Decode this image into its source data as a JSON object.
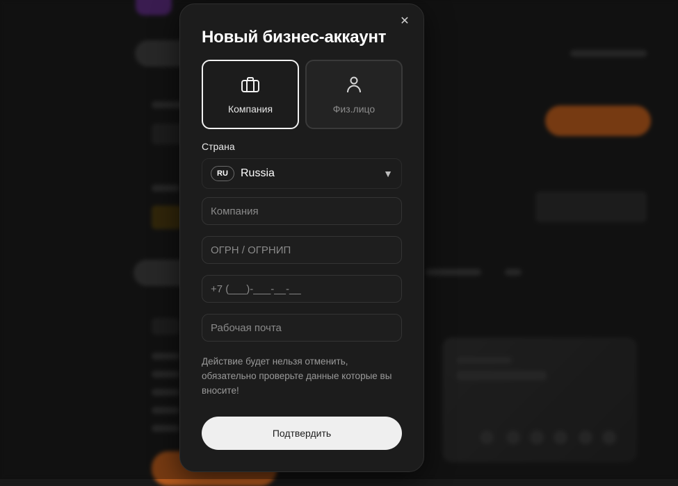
{
  "modal": {
    "title": "Новый бизнес-аккаунт",
    "close_glyph": "✕",
    "account_types": [
      {
        "label": "Компания",
        "icon": "briefcase-icon",
        "selected": true
      },
      {
        "label": "Физ.лицо",
        "icon": "person-icon",
        "selected": false
      }
    ],
    "country": {
      "label": "Страна",
      "code": "RU",
      "name": "Russia",
      "caret": "▼"
    },
    "fields": {
      "company_placeholder": "Компания",
      "ogrn_placeholder": "ОГРН / ОГРНИП",
      "phone_placeholder": "+7 (___)-___-__-__",
      "email_placeholder": "Рабочая почта"
    },
    "warning": "Действие будет нельзя отменить, обязательно проверьте данные которые вы вносите!",
    "confirm_label": "Подтвердить"
  },
  "colors": {
    "modal_bg": "#1c1c1c",
    "accent_orange": "#b55a1d",
    "button_bg": "#efefef"
  }
}
